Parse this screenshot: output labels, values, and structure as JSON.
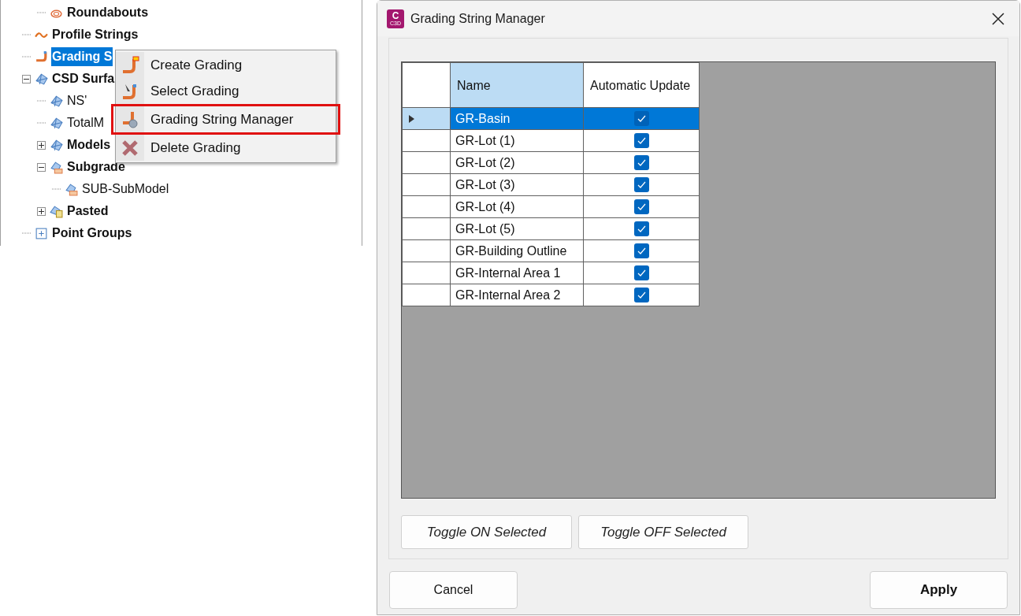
{
  "tree_upper_children": [
    {
      "label": "Roundabouts",
      "bold": true,
      "selected": false,
      "kind": "roundabout"
    }
  ],
  "tree": [
    {
      "label": "Profile Strings",
      "bold": true,
      "selected": false,
      "kind": "profile"
    },
    {
      "label": "Grading S",
      "bold": true,
      "selected": true,
      "kind": "grading"
    },
    {
      "label": "CSD Surfa",
      "bold": true,
      "selected": false,
      "expanded": true,
      "kind": "surface",
      "children": [
        {
          "label": "NS'",
          "bold": false,
          "selected": false,
          "kind": "surface"
        },
        {
          "label": "TotalM",
          "bold": false,
          "selected": false,
          "kind": "surface"
        },
        {
          "label": "Models",
          "bold": true,
          "selected": false,
          "expanded": false,
          "kind": "surface"
        },
        {
          "label": "Subgrade",
          "bold": true,
          "selected": false,
          "expanded": true,
          "kind": "folder",
          "children": [
            {
              "label": "SUB-SubModel",
              "bold": false,
              "selected": false,
              "kind": "folder"
            }
          ]
        },
        {
          "label": "Pasted",
          "bold": true,
          "selected": false,
          "expanded": false,
          "kind": "pasted"
        }
      ]
    },
    {
      "label": "Point Groups",
      "bold": true,
      "selected": false,
      "kind": "points"
    }
  ],
  "context_menu": [
    {
      "label": "Create Grading",
      "highlighted": false,
      "kind": "create"
    },
    {
      "label": "Select Grading",
      "highlighted": false,
      "kind": "select"
    },
    {
      "label": "Grading String Manager",
      "highlighted": true,
      "kind": "manager"
    },
    {
      "label": "Delete Grading",
      "highlighted": false,
      "kind": "delete"
    }
  ],
  "dialog": {
    "title": "Grading String Manager",
    "app_icon_letter": "C",
    "app_icon_sub": "C3D",
    "table": {
      "columns": [
        "Name",
        "Automatic Update"
      ],
      "rows": [
        {
          "name": "GR-Basin",
          "automatic_update": true,
          "selected": true
        },
        {
          "name": "GR-Lot (1)",
          "automatic_update": true,
          "selected": false
        },
        {
          "name": "GR-Lot (2)",
          "automatic_update": true,
          "selected": false
        },
        {
          "name": "GR-Lot (3)",
          "automatic_update": true,
          "selected": false
        },
        {
          "name": "GR-Lot (4)",
          "automatic_update": true,
          "selected": false
        },
        {
          "name": "GR-Lot (5)",
          "automatic_update": true,
          "selected": false
        },
        {
          "name": "GR-Building Outline",
          "automatic_update": true,
          "selected": false
        },
        {
          "name": "GR-Internal Area 1",
          "automatic_update": true,
          "selected": false
        },
        {
          "name": "GR-Internal Area 2",
          "automatic_update": true,
          "selected": false
        }
      ]
    },
    "toggle_buttons": [
      "Toggle ON Selected",
      "Toggle OFF Selected"
    ],
    "cancel_button": "Cancel",
    "apply_button": "Apply"
  }
}
